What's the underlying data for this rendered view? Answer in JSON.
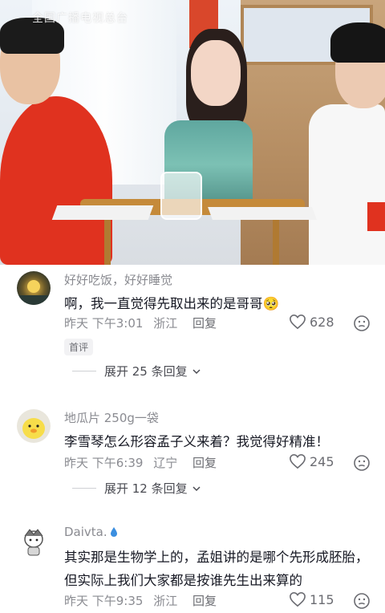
{
  "video": {
    "watermark": "全国广播电视总台"
  },
  "comments": [
    {
      "username": "好好吃饭，好好睡觉",
      "text": "啊，我一直觉得先取出来的是哥哥🥺",
      "time": "昨天 下午3:01",
      "location": "浙江",
      "reply_label": "回复",
      "likes": "628",
      "tag": "首评",
      "expand_label": "展开 25 条回复",
      "avatar": "sunset-moon-avatar"
    },
    {
      "username": "地瓜片 250g一袋",
      "text": "李雪琴怎么形容孟子义来着？我觉得好精准！",
      "time": "昨天 下午6:39",
      "location": "辽宁",
      "reply_label": "回复",
      "likes": "245",
      "expand_label": "展开 12 条回复",
      "avatar": "duck-avatar"
    },
    {
      "username": "Daivta.",
      "text": "其实那是生物学上的，孟姐讲的是哪个先形成胚胎，但实际上我们大家都是按谁先生出来算的",
      "time": "昨天 下午9:35",
      "location": "浙江",
      "reply_label": "回复",
      "likes": "115",
      "avatar": "cartoon-avatar"
    }
  ],
  "colors": {
    "secondary_text": "#8a8b91",
    "primary_text": "#161823",
    "accent_red": "#e0321f"
  }
}
